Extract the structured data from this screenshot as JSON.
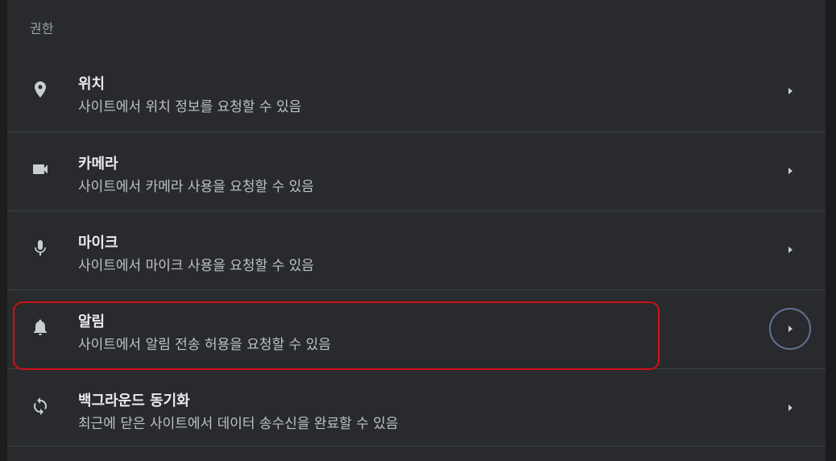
{
  "section": {
    "title": "권한"
  },
  "permissions": [
    {
      "title": "위치",
      "subtitle": "사이트에서 위치 정보를 요청할 수 있음",
      "icon": "location-pin-icon"
    },
    {
      "title": "카메라",
      "subtitle": "사이트에서 카메라 사용을 요청할 수 있음",
      "icon": "camera-icon"
    },
    {
      "title": "마이크",
      "subtitle": "사이트에서 마이크 사용을 요청할 수 있음",
      "icon": "microphone-icon"
    },
    {
      "title": "알림",
      "subtitle": "사이트에서 알림 전송 허용을 요청할 수 있음",
      "icon": "bell-icon"
    },
    {
      "title": "백그라운드 동기화",
      "subtitle": "최근에 닫은 사이트에서 데이터 송수신을 완료할 수 있음",
      "icon": "sync-icon"
    }
  ],
  "colors": {
    "panel_background": "#292a2d",
    "divider": "#3c4043",
    "highlight": "#d0101a",
    "focus_ring": "#5f7394"
  }
}
